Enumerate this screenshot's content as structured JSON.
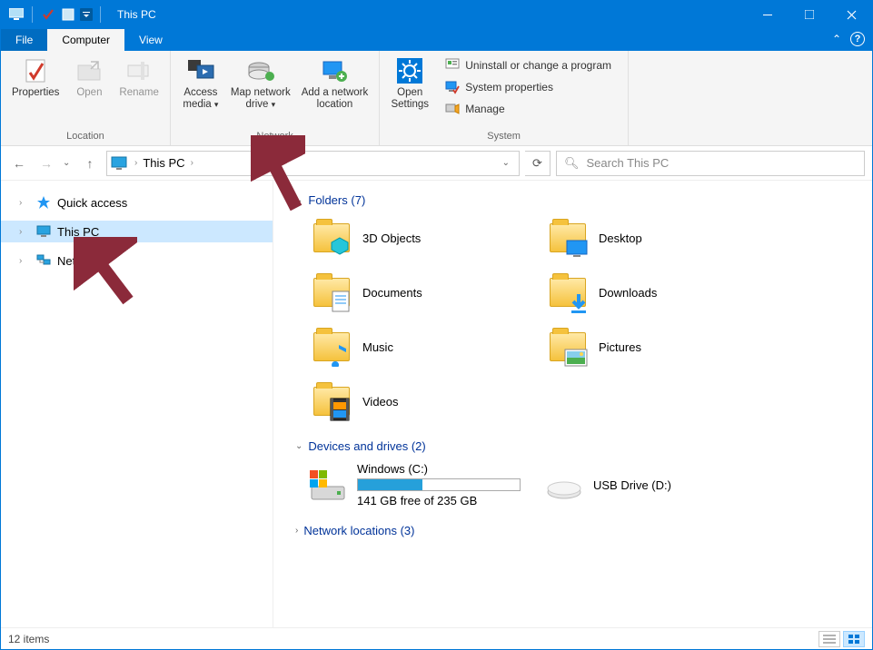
{
  "window": {
    "title": "This PC"
  },
  "tabs": {
    "file": "File",
    "computer": "Computer",
    "view": "View"
  },
  "ribbon": {
    "location": {
      "properties": "Properties",
      "open": "Open",
      "rename": "Rename",
      "label": "Location"
    },
    "network": {
      "access_media": "Access\nmedia",
      "map_drive": "Map network\ndrive",
      "add_location": "Add a network\nlocation",
      "label": "Network"
    },
    "system": {
      "open_settings": "Open\nSettings",
      "uninstall": "Uninstall or change a program",
      "properties": "System properties",
      "manage": "Manage",
      "label": "System"
    }
  },
  "address": {
    "crumb": "This PC"
  },
  "search": {
    "placeholder": "Search This PC"
  },
  "nav": {
    "quick_access": "Quick access",
    "this_pc": "This PC",
    "network": "Network"
  },
  "sections": {
    "folders": {
      "title": "Folders",
      "count": 7
    },
    "devices": {
      "title": "Devices and drives",
      "count": 2
    },
    "netloc": {
      "title": "Network locations",
      "count": 3
    }
  },
  "folders": {
    "objects3d": "3D Objects",
    "desktop": "Desktop",
    "documents": "Documents",
    "downloads": "Downloads",
    "music": "Music",
    "pictures": "Pictures",
    "videos": "Videos"
  },
  "drives": {
    "c": {
      "name": "Windows (C:)",
      "free": "141 GB free of 235 GB",
      "fill_pct": 40
    },
    "d": {
      "name": "USB Drive (D:)"
    }
  },
  "status": {
    "items": "12 items"
  }
}
